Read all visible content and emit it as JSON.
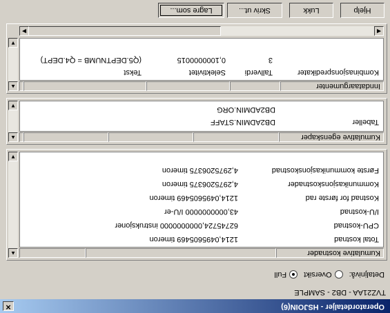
{
  "window": {
    "title": "Operatordetaljer - HSJOIN(6)",
    "subtitle": "TVZ21AA - DB2 - SAMPLE"
  },
  "detail": {
    "label": "Detaljnivå:",
    "option_overview": "Oversikt",
    "option_full": "Full",
    "selected": "Full"
  },
  "costs": {
    "columns": [
      "Kumulative kostnader",
      "",
      ""
    ],
    "rows": [
      [
        "Total kostnad",
        "1214,0495605469 timeron"
      ],
      [
        "CPU-kostnad",
        "62745724,0000000000 instruksjoner"
      ],
      [
        "I/U-kostnad",
        "43,0000000000 I/U-er"
      ],
      [
        "Kostnad for første rad",
        "1214,0495605469 timeron"
      ],
      [
        "Kommunikasjonskostnader",
        "4,2975206375 timeron"
      ],
      [
        "Første kommunikasjonskostnad",
        "4,2975206375 timeron"
      ]
    ]
  },
  "props": {
    "columns": [
      "Kumulative egenskaper",
      "",
      "",
      "",
      ""
    ],
    "label": "Tabeller",
    "values": [
      "DB2ADMIN.STAFF",
      "DB2ADMIN.ORG"
    ]
  },
  "args": {
    "columns": [
      "Inndataargumenter",
      "",
      "",
      "",
      ""
    ],
    "headers": [
      "Kombinasjonspredikater",
      "Tallverdi",
      "Selektivitet",
      "Tekst"
    ],
    "row": [
      "",
      "3",
      "0,1000000015",
      "(Q5.DEPTNUMB = Q4.DEPT)"
    ]
  },
  "buttons": {
    "save": "Lagre som...",
    "print": "Skriv ut...",
    "close": "Lukk",
    "help": "Hjelp"
  }
}
